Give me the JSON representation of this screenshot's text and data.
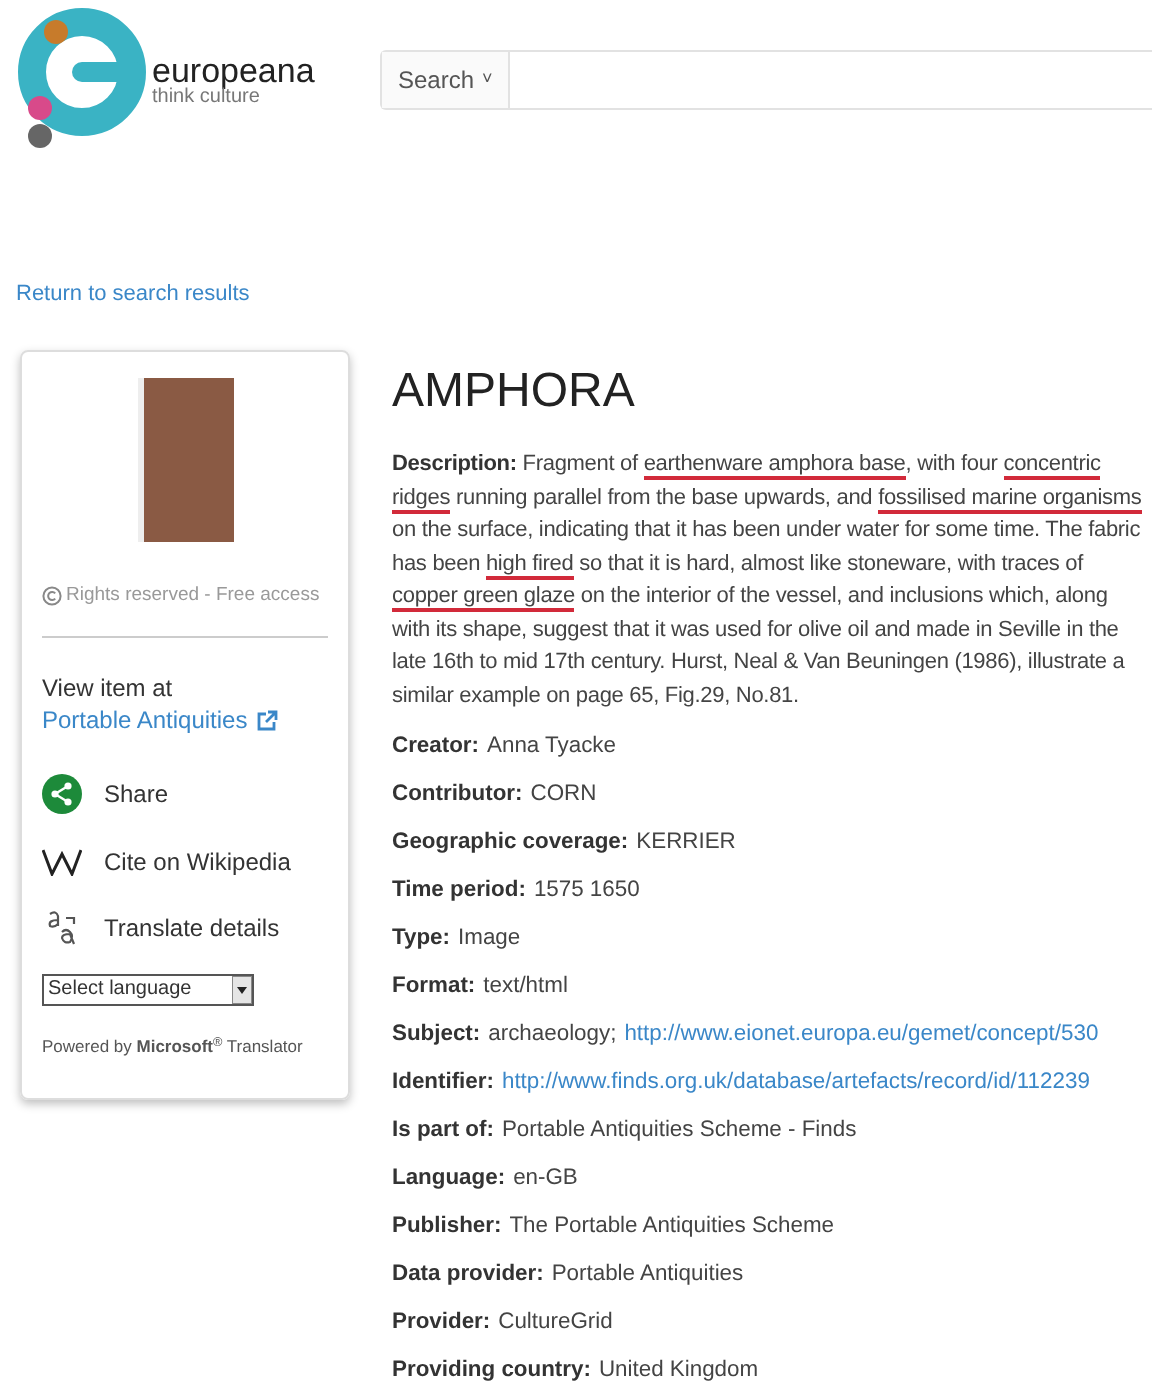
{
  "header": {
    "logo": {
      "name": "europeana",
      "tagline": "think culture"
    },
    "search": {
      "scope": "Search",
      "caret": "˅"
    }
  },
  "back_link": "Return to search results",
  "sidebar": {
    "rights": "Rights reserved - Free access",
    "view_at": "View item at",
    "provider_link": "Portable Antiquities",
    "actions": [
      {
        "kind": "share",
        "label": "Share"
      },
      {
        "kind": "wikipedia",
        "label": "Cite on Wikipedia"
      },
      {
        "kind": "translate",
        "label": "Translate details"
      }
    ],
    "language_select": "Select language",
    "powered_by": "Powered by **Microsoft**$^{®}$ Translator"
  },
  "title": "AMPHORA",
  "description": {
    "label": "Description:",
    "segments": [
      {
        "text": "Fragment of ",
        "underlined": false
      },
      {
        "text": "earthenware amphora base",
        "underlined": true
      },
      {
        "text": ", with four ",
        "underlined": false
      },
      {
        "text": "concentric ridges",
        "underlined": true
      },
      {
        "text": " running parallel from the base upwards, and ",
        "underlined": false
      },
      {
        "text": "fossilised marine organisms",
        "underlined": true
      },
      {
        "text": " on the surface, indicating that it has been under water for some time. The fabric has been ",
        "underlined": false
      },
      {
        "text": "high fired",
        "underlined": true
      },
      {
        "text": " so that it is hard, almost like stoneware, with traces of ",
        "underlined": false
      },
      {
        "text": "copper green glaze",
        "underlined": true
      },
      {
        "text": " on the interior of the vessel, and inclusions which, along with its shape, suggest that it was used for olive oil and made in Seville in the late 16th to mid 17th century. Hurst, Neal & Van Beuningen (1986), illustrate a similar example on page 65, Fig.29, No.81.",
        "underlined": false
      }
    ]
  },
  "fields": [
    {
      "label": "Creator:",
      "parts": [
        {
          "kind": "text",
          "text": "Anna Tyacke"
        }
      ]
    },
    {
      "label": "Contributor:",
      "parts": [
        {
          "kind": "text",
          "text": "CORN"
        }
      ]
    },
    {
      "label": "Geographic coverage:",
      "parts": [
        {
          "kind": "text",
          "text": "KERRIER"
        }
      ]
    },
    {
      "label": "Time period:",
      "parts": [
        {
          "kind": "text",
          "text": "1575 1650"
        }
      ]
    },
    {
      "label": "Type:",
      "parts": [
        {
          "kind": "text",
          "text": "Image"
        }
      ]
    },
    {
      "label": "Format:",
      "parts": [
        {
          "kind": "text",
          "text": "text/html"
        }
      ]
    },
    {
      "label": "Subject:",
      "parts": [
        {
          "kind": "text",
          "text": "archaeology;"
        },
        {
          "kind": "link",
          "text": "http://www.eionet.europa.eu/gemet/concept/530"
        }
      ]
    },
    {
      "label": "Identifier:",
      "parts": [
        {
          "kind": "link",
          "text": "http://www.finds.org.uk/database/artefacts/record/id/112239"
        }
      ]
    },
    {
      "label": "Is part of:",
      "parts": [
        {
          "kind": "text",
          "text": "Portable Antiquities Scheme - Finds"
        }
      ]
    },
    {
      "label": "Language:",
      "parts": [
        {
          "kind": "text",
          "text": "en-GB"
        }
      ]
    },
    {
      "label": "Publisher:",
      "parts": [
        {
          "kind": "text",
          "text": "The Portable Antiquities Scheme"
        }
      ]
    },
    {
      "label": "Data provider:",
      "parts": [
        {
          "kind": "text",
          "text": "Portable Antiquities"
        }
      ]
    },
    {
      "label": "Provider:",
      "parts": [
        {
          "kind": "text",
          "text": "CultureGrid"
        }
      ]
    },
    {
      "label": "Providing country:",
      "parts": [
        {
          "kind": "text",
          "text": "United Kingdom"
        }
      ]
    }
  ]
}
